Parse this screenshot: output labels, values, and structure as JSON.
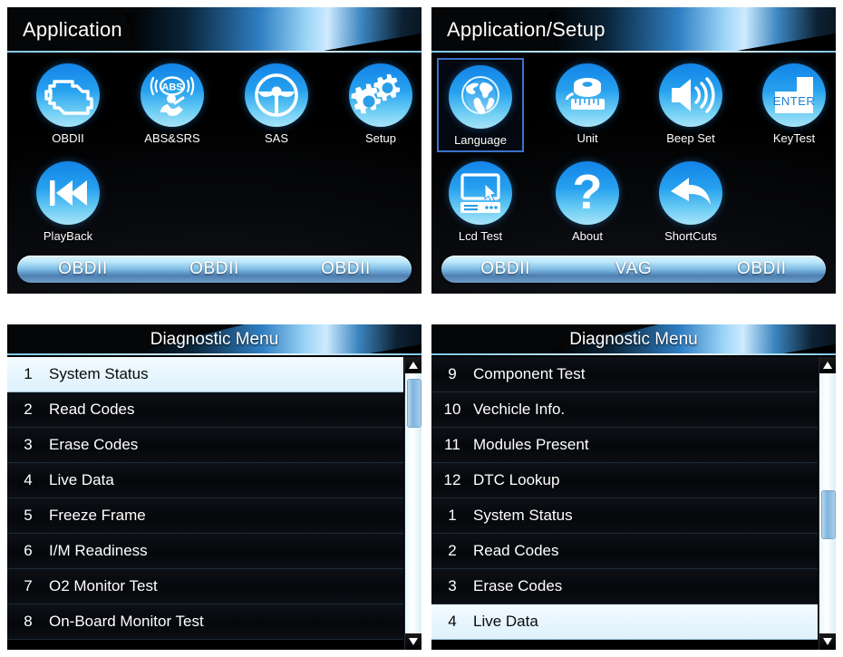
{
  "colors": {
    "icon_blue_top": "#1384e8",
    "icon_blue_bottom": "#a9e4f8",
    "selection_border": "#3a72c8",
    "highlight_row_bg": "#eaf7fe",
    "panel_bg": "#000000",
    "fnbar_text": "#ffffff"
  },
  "panels": {
    "application": {
      "title": "Application",
      "icons": [
        {
          "label": "OBDII",
          "icon": "engine-icon",
          "selected": false
        },
        {
          "label": "ABS&SRS",
          "icon": "abs-srs-icon",
          "selected": false
        },
        {
          "label": "SAS",
          "icon": "steering-wheel-icon",
          "selected": false
        },
        {
          "label": "Setup",
          "icon": "gears-icon",
          "selected": false
        },
        {
          "label": "PlayBack",
          "icon": "rewind-icon",
          "selected": false
        }
      ],
      "function_bar": [
        "OBDII",
        "OBDII",
        "OBDII"
      ]
    },
    "application_setup": {
      "title": "Application/Setup",
      "icons": [
        {
          "label": "Language",
          "icon": "globe-icon",
          "selected": true
        },
        {
          "label": "Unit",
          "icon": "tape-measure-icon",
          "selected": false
        },
        {
          "label": "Beep Set",
          "icon": "speaker-icon",
          "selected": false
        },
        {
          "label": "KeyTest",
          "icon": "enter-key-icon",
          "selected": false
        },
        {
          "label": "Lcd Test",
          "icon": "monitor-cursor-icon",
          "selected": false
        },
        {
          "label": "About",
          "icon": "question-mark-icon",
          "selected": false
        },
        {
          "label": "ShortCuts",
          "icon": "back-arrow-icon",
          "selected": false
        }
      ],
      "function_bar": [
        "OBDII",
        "VAG",
        "OBDII"
      ]
    },
    "diagnostic_menu_page1": {
      "title": "Diagnostic Menu",
      "rows": [
        {
          "num": "1",
          "label": "System  Status",
          "highlighted": true
        },
        {
          "num": "2",
          "label": "Read Codes",
          "highlighted": false
        },
        {
          "num": "3",
          "label": "Erase Codes",
          "highlighted": false
        },
        {
          "num": "4",
          "label": "Live Data",
          "highlighted": false
        },
        {
          "num": "5",
          "label": "Freeze Frame",
          "highlighted": false
        },
        {
          "num": "6",
          "label": "I/M Readiness",
          "highlighted": false
        },
        {
          "num": "7",
          "label": "O2 Monitor Test",
          "highlighted": false
        },
        {
          "num": "8",
          "label": "On-Board Monitor Test",
          "highlighted": false
        }
      ],
      "scrollbar": {
        "thumb_top_pct": 2,
        "thumb_height_pct": 16
      }
    },
    "diagnostic_menu_page2": {
      "title": "Diagnostic Menu",
      "rows": [
        {
          "num": "9",
          "label": "Component Test",
          "highlighted": false
        },
        {
          "num": "10",
          "label": "Vechicle Info.",
          "highlighted": false
        },
        {
          "num": "11",
          "label": "Modules Present",
          "highlighted": false
        },
        {
          "num": "12",
          "label": " DTC Lookup",
          "highlighted": false
        },
        {
          "num": "1",
          "label": "System Status",
          "highlighted": false
        },
        {
          "num": "2",
          "label": "Read Codes",
          "highlighted": false
        },
        {
          "num": "3",
          "label": "Erase Codes",
          "highlighted": false
        },
        {
          "num": "4",
          "label": "Live Data",
          "highlighted": true
        }
      ],
      "scrollbar": {
        "thumb_top_pct": 40,
        "thumb_height_pct": 16
      }
    }
  }
}
